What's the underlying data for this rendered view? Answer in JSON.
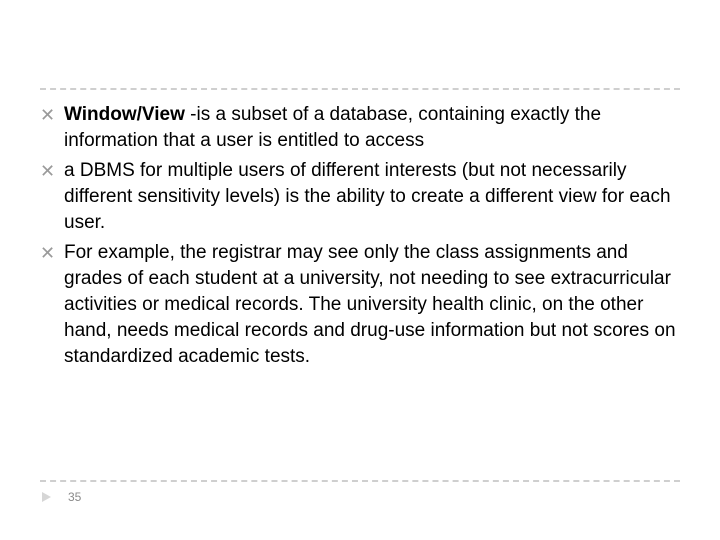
{
  "bullets": {
    "items": [
      {
        "bold_lead": "Window/View ",
        "rest": "-is a subset of a database, containing exactly the information that a user is entitled to access"
      },
      {
        "bold_lead": "",
        "rest": "a DBMS for multiple users of different interests (but not necessarily different sensitivity levels) is the ability to create a different view for each user."
      },
      {
        "bold_lead": "",
        "rest": "For example, the registrar may see only the class assignments and grades of each student at a university, not needing to see extracurricular activities or medical records. The university health clinic, on the other hand, needs medical records and drug-use information but not scores on standardized academic tests."
      }
    ]
  },
  "footer": {
    "page_number": "35"
  },
  "glyphs": {
    "bullet_marker": "✕"
  }
}
